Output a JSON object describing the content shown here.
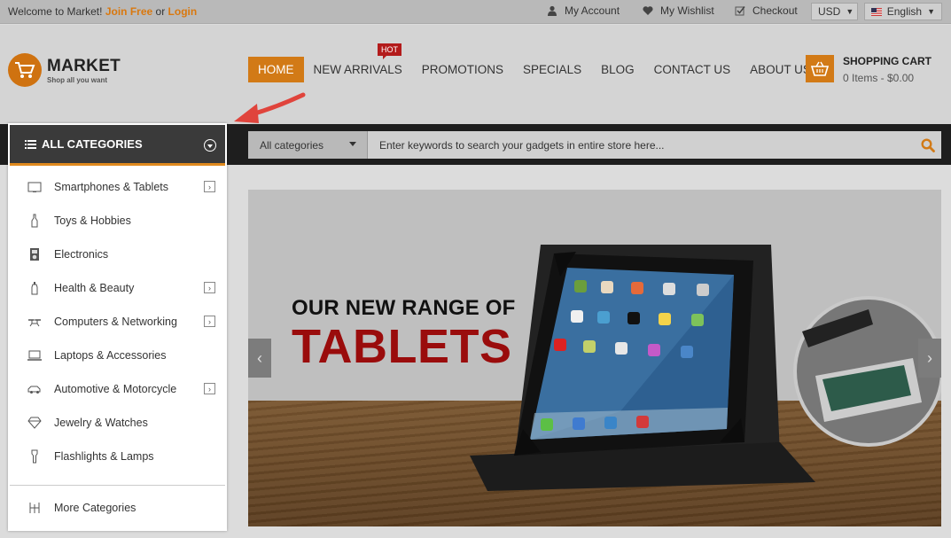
{
  "topbar": {
    "welcome_text": "Welcome to Market!",
    "join_label": "Join Free",
    "or_text": "or",
    "login_label": "Login",
    "my_account": "My Account",
    "my_wishlist": "My Wishlist",
    "checkout": "Checkout",
    "currency": "USD",
    "language": "English"
  },
  "header": {
    "logo_title": "MARKET",
    "logo_tagline": "Shop all you want",
    "nav": [
      "HOME",
      "NEW ARRIVALS",
      "PROMOTIONS",
      "SPECIALS",
      "BLOG",
      "CONTACT US",
      "ABOUT US"
    ],
    "hot_badge": "HOT",
    "cart_title": "SHOPPING CART",
    "cart_summary": "0 Items - $0.00"
  },
  "search": {
    "category_value": "All categories",
    "placeholder": "Enter keywords to search your gadgets in entire store here..."
  },
  "categories": {
    "title": "ALL CATEGORIES",
    "items": [
      {
        "label": "Smartphones & Tablets",
        "icon": "tablet-icon",
        "expandable": true
      },
      {
        "label": "Toys & Hobbies",
        "icon": "bottle-icon",
        "expandable": false
      },
      {
        "label": "Electronics",
        "icon": "ipod-icon",
        "expandable": false
      },
      {
        "label": "Health & Beauty",
        "icon": "perfume-icon",
        "expandable": true
      },
      {
        "label": "Computers & Networking",
        "icon": "drone-icon",
        "expandable": true
      },
      {
        "label": "Laptops & Accessories",
        "icon": "laptop-icon",
        "expandable": false
      },
      {
        "label": "Automotive & Motorcycle",
        "icon": "car-icon",
        "expandable": true
      },
      {
        "label": "Jewelry & Watches",
        "icon": "diamond-icon",
        "expandable": false
      },
      {
        "label": "Flashlights & Lamps",
        "icon": "flashlight-icon",
        "expandable": false
      }
    ],
    "more_label": "More Categories"
  },
  "slider": {
    "headline_small": "OUR NEW RANGE OF",
    "headline_big": "TABLETS"
  },
  "colors": {
    "accent": "#d27a16",
    "hot_red": "#b31b1b",
    "headline_red": "#9a0c0c"
  }
}
